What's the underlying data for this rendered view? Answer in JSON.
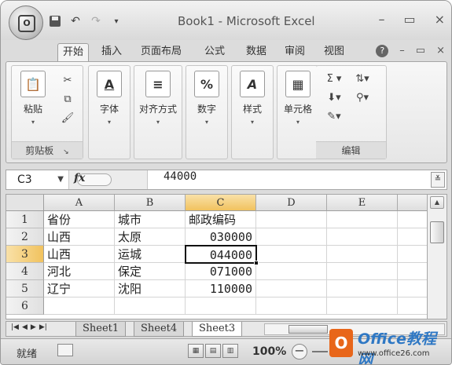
{
  "titlebar": {
    "title": "Book1 - Microsoft Excel",
    "minimize": "–",
    "maximize": "▭",
    "close": "×"
  },
  "tabs": [
    {
      "label": "开始"
    },
    {
      "label": "插入"
    },
    {
      "label": "页面布局"
    },
    {
      "label": "公式"
    },
    {
      "label": "数据"
    },
    {
      "label": "审阅"
    },
    {
      "label": "视图"
    }
  ],
  "ribbon": {
    "paste_label": "粘贴",
    "clipboard_group": "剪贴板",
    "font_label": "字体",
    "align_label": "对齐方式",
    "number_label": "数字",
    "style_label": "样式",
    "cells_label": "单元格",
    "edit_group": "编辑",
    "font_icon": "A",
    "number_icon": "%",
    "style_icon": "A"
  },
  "formula_bar": {
    "name_box": "C3",
    "fx": "fx",
    "formula": "44000"
  },
  "grid": {
    "columns": [
      "A",
      "B",
      "C",
      "D",
      "E"
    ],
    "rows": [
      "1",
      "2",
      "3",
      "4",
      "5",
      "6"
    ],
    "cells": [
      [
        "省份",
        "城市",
        "邮政编码"
      ],
      [
        "山西",
        "太原",
        "030000"
      ],
      [
        "山西",
        "运城",
        "044000"
      ],
      [
        "河北",
        "保定",
        "071000"
      ],
      [
        "辽宁",
        "沈阳",
        "110000"
      ]
    ]
  },
  "sheets": [
    "Sheet1",
    "Sheet4",
    "Sheet3"
  ],
  "statusbar": {
    "ready": "就绪",
    "zoom": "100%"
  },
  "watermark": {
    "title": "Office教程网",
    "url": "www.office26.com"
  }
}
